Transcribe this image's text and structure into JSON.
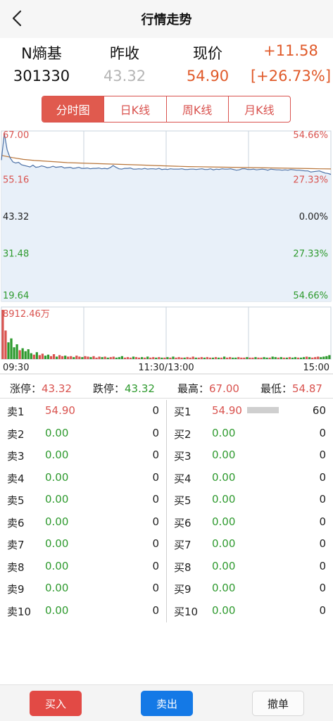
{
  "header": {
    "title": "行情走势",
    "back_icon": "chevron-left-icon"
  },
  "quote": {
    "name": "N熵基",
    "code": "301330",
    "prev_close_label": "昨收",
    "prev_close": "43.32",
    "price_label": "现价",
    "price": "54.90",
    "change": "+11.58",
    "change_pct": "[+26.73%]"
  },
  "tabs": [
    {
      "label": "分时图",
      "active": true
    },
    {
      "label": "日K线",
      "active": false
    },
    {
      "label": "周K线",
      "active": false
    },
    {
      "label": "月K线",
      "active": false
    }
  ],
  "colors": {
    "up": "#d9534f",
    "down": "#2e9a2e",
    "flat": "#222222",
    "price_line": "#4a6fa5",
    "avg_line": "#b8753a",
    "chart_fill": "#e8f0f9",
    "grid": "#c9d3de"
  },
  "chart_data": {
    "type": "line",
    "title": "",
    "y_left_labels": [
      "67.00",
      "55.16",
      "43.32",
      "31.48",
      "19.64"
    ],
    "y_right_labels": [
      "54.66%",
      "27.33%",
      "0.00%",
      "27.33%",
      "54.66%"
    ],
    "ylim": [
      19.64,
      67.0
    ],
    "x_labels": [
      "09:30",
      "11:30/13:00",
      "15:00"
    ],
    "series": [
      {
        "values": [
          58.9,
          66.4,
          61.8,
          59.6,
          58.4,
          58.1,
          58.3,
          57.6,
          57.4,
          57.2,
          57.0,
          57.5,
          56.9,
          57.0,
          57.3,
          57.1,
          56.8,
          56.9,
          57.2,
          56.9,
          57.0,
          57.1,
          56.7,
          56.8,
          56.9,
          56.6,
          56.7,
          56.9,
          56.6,
          56.6,
          56.7,
          56.5,
          56.6,
          56.6,
          56.7,
          56.5,
          56.6,
          56.5,
          56.8,
          57.4,
          56.9,
          56.5,
          56.4,
          56.6,
          56.6,
          56.7,
          56.4,
          56.4,
          56.5,
          56.4,
          56.6,
          56.4,
          56.5,
          56.5,
          56.4,
          56.6,
          56.3,
          56.4,
          56.3,
          56.5,
          56.4,
          56.4,
          56.4,
          56.5,
          56.3,
          56.3,
          56.4,
          56.4,
          56.3,
          56.4,
          56.5,
          56.3,
          56.3,
          56.5,
          56.2,
          56.4,
          56.3,
          56.5,
          56.4,
          56.4,
          56.5,
          56.3,
          56.1,
          56.2,
          56.5,
          56.5,
          56.3,
          56.3,
          56.4,
          56.2,
          56.3,
          56.4,
          56.3,
          56.1,
          56.4,
          56.3,
          56.2,
          56.2,
          56.1,
          56.2,
          56.1,
          56.3,
          56.2,
          56.1,
          56.1,
          56.0,
          55.9,
          55.9,
          55.6,
          55.7,
          55.8,
          55.9,
          55.6,
          55.3,
          55.2,
          54.9
        ]
      },
      {
        "values": [
          60.2,
          59.6,
          59.1,
          58.8,
          58.6,
          58.4,
          58.2,
          58.1,
          58.0,
          57.9,
          57.8,
          57.7,
          57.6,
          57.5,
          57.4,
          57.3,
          57.2,
          57.1,
          57.05,
          57.0,
          56.95,
          56.9,
          56.85,
          56.8,
          56.75,
          56.7,
          56.65,
          56.6,
          56.55,
          56.5,
          56.45
        ]
      }
    ],
    "volume_label": "8912.46万",
    "volume_series": [
      {
        "name": "",
        "values": [
          100,
          58,
          34,
          42,
          24,
          30,
          18,
          22,
          16,
          20,
          12,
          9,
          14,
          8,
          11,
          7,
          9,
          6,
          10,
          5,
          8,
          6,
          7,
          5,
          6,
          4,
          7,
          5,
          4,
          6,
          5,
          4,
          6,
          3,
          5,
          4,
          5,
          3,
          4,
          5,
          3,
          4,
          6,
          3,
          4,
          3,
          5,
          4,
          3,
          4,
          3,
          5,
          3,
          4,
          3,
          4,
          3,
          3,
          4,
          3,
          5,
          3,
          4,
          3,
          3,
          4,
          3,
          5,
          3,
          3,
          4,
          3,
          4,
          3,
          3,
          4,
          3,
          3,
          5,
          3,
          4,
          3,
          3,
          4,
          3,
          3,
          4,
          3,
          3,
          4,
          3,
          3,
          4,
          3,
          3,
          5,
          4,
          3,
          4,
          3,
          3,
          4,
          3,
          4,
          3,
          3,
          4,
          5,
          4,
          3,
          4,
          5,
          4,
          5,
          6,
          8
        ]
      }
    ]
  },
  "stats": [
    {
      "label": "涨停：",
      "value": "43.32",
      "color": "#d9534f"
    },
    {
      "label": "跌停：",
      "value": "43.32",
      "color": "#2e9a2e"
    },
    {
      "label": "最高：",
      "value": "67.00",
      "color": "#d9534f"
    },
    {
      "label": "最低：",
      "value": "54.87",
      "color": "#d9534f"
    }
  ],
  "sell_orders": [
    {
      "label": "卖1",
      "price": "54.90",
      "volume": "0",
      "color": "#d9534f"
    },
    {
      "label": "卖2",
      "price": "0.00",
      "volume": "0",
      "color": "#2e9a2e"
    },
    {
      "label": "卖3",
      "price": "0.00",
      "volume": "0",
      "color": "#2e9a2e"
    },
    {
      "label": "卖4",
      "price": "0.00",
      "volume": "0",
      "color": "#2e9a2e"
    },
    {
      "label": "卖5",
      "price": "0.00",
      "volume": "0",
      "color": "#2e9a2e"
    },
    {
      "label": "卖6",
      "price": "0.00",
      "volume": "0",
      "color": "#2e9a2e"
    },
    {
      "label": "卖7",
      "price": "0.00",
      "volume": "0",
      "color": "#2e9a2e"
    },
    {
      "label": "卖8",
      "price": "0.00",
      "volume": "0",
      "color": "#2e9a2e"
    },
    {
      "label": "卖9",
      "price": "0.00",
      "volume": "0",
      "color": "#2e9a2e"
    },
    {
      "label": "卖10",
      "price": "0.00",
      "volume": "0",
      "color": "#2e9a2e"
    }
  ],
  "buy_orders": [
    {
      "label": "买1",
      "price": "54.90",
      "volume": "60",
      "color": "#d9534f",
      "depth": 0.45
    },
    {
      "label": "买2",
      "price": "0.00",
      "volume": "0",
      "color": "#2e9a2e",
      "depth": 0
    },
    {
      "label": "买3",
      "price": "0.00",
      "volume": "0",
      "color": "#2e9a2e",
      "depth": 0
    },
    {
      "label": "买4",
      "price": "0.00",
      "volume": "0",
      "color": "#2e9a2e",
      "depth": 0
    },
    {
      "label": "买5",
      "price": "0.00",
      "volume": "0",
      "color": "#2e9a2e",
      "depth": 0
    },
    {
      "label": "买6",
      "price": "0.00",
      "volume": "0",
      "color": "#2e9a2e",
      "depth": 0
    },
    {
      "label": "买7",
      "price": "0.00",
      "volume": "0",
      "color": "#2e9a2e",
      "depth": 0
    },
    {
      "label": "买8",
      "price": "0.00",
      "volume": "0",
      "color": "#2e9a2e",
      "depth": 0
    },
    {
      "label": "买9",
      "price": "0.00",
      "volume": "0",
      "color": "#2e9a2e",
      "depth": 0
    },
    {
      "label": "买10",
      "price": "0.00",
      "volume": "0",
      "color": "#2e9a2e",
      "depth": 0
    }
  ],
  "footer": {
    "buy_label": "买入",
    "sell_label": "卖出",
    "cancel_label": "撤单"
  }
}
